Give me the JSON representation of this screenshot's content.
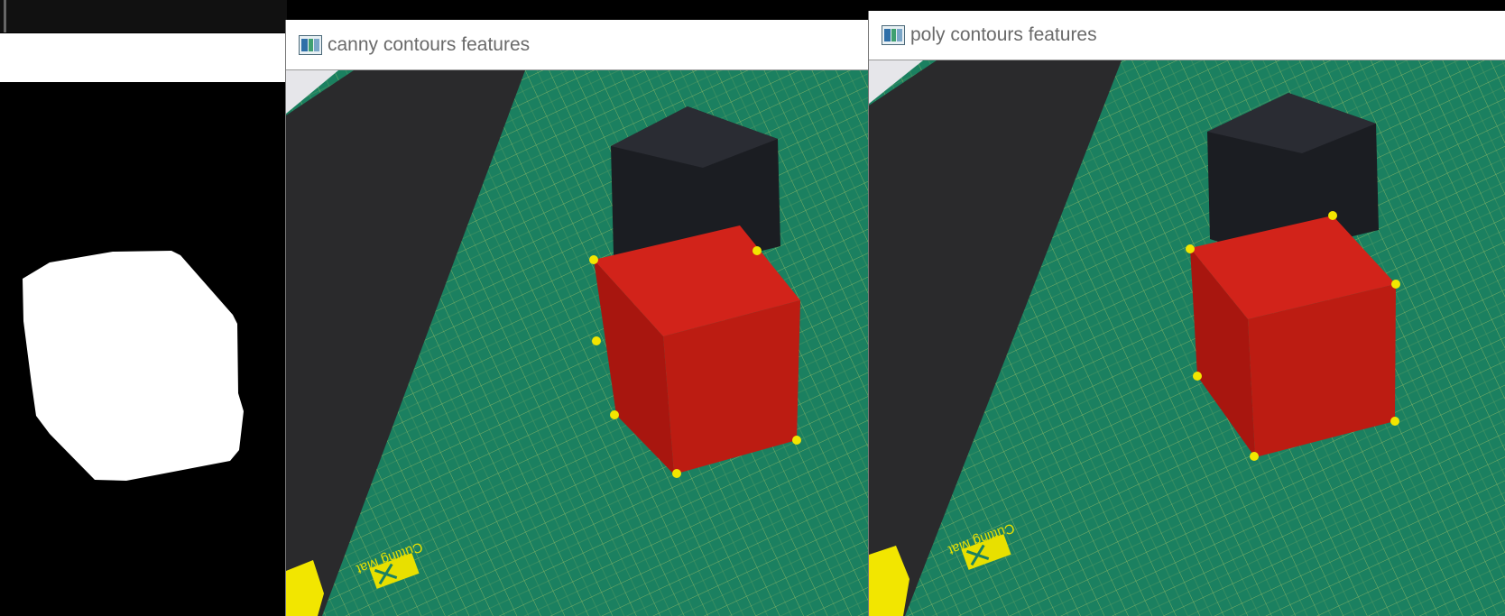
{
  "windows": {
    "mask": {
      "title": "",
      "image": "binary-mask-of-cube"
    },
    "canny": {
      "title": "canny contours features",
      "image": "cubes-on-cutting-mat-with-corner-points"
    },
    "poly": {
      "title": "poly contours features",
      "image": "cubes-on-cutting-mat-with-corner-points"
    }
  },
  "photo": {
    "mat_text": "Cutting Mat"
  },
  "colors": {
    "mat": "#1b8060",
    "grid_line": "#c8d46a",
    "red_cube": "#c01c12",
    "dark_cube": "#1b1d22",
    "feature_point": "#f2e600",
    "mask_fg": "#ffffff",
    "mask_bg": "#000000"
  }
}
